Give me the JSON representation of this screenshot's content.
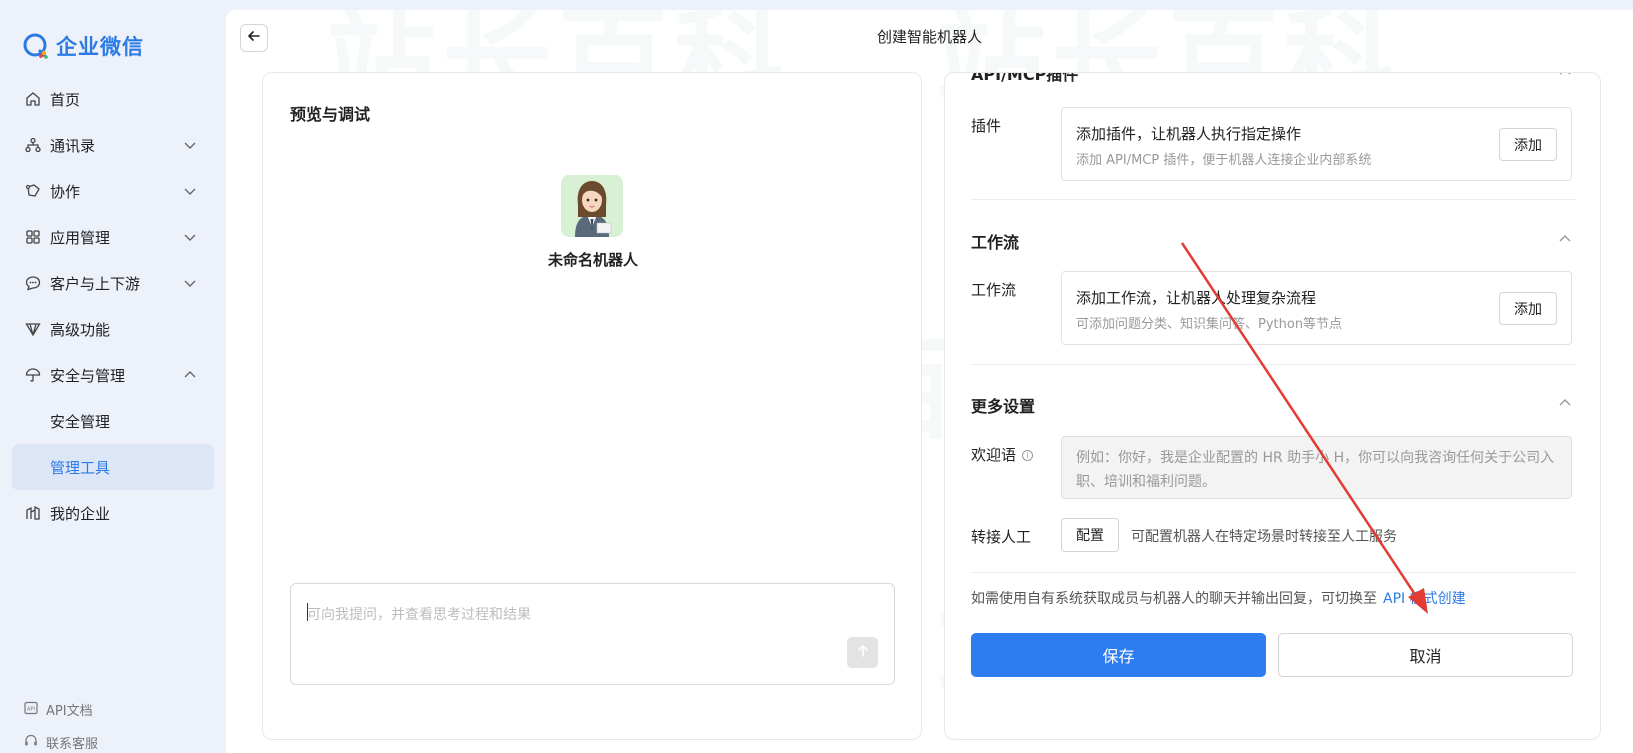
{
  "app": {
    "name": "企业微信"
  },
  "sidebar": {
    "items": [
      {
        "label": "首页",
        "icon": "home-icon"
      },
      {
        "label": "通讯录",
        "icon": "org-chart-icon"
      },
      {
        "label": "协作",
        "icon": "collaboration-icon"
      },
      {
        "label": "应用管理",
        "icon": "apps-grid-icon"
      },
      {
        "label": "客户与上下游",
        "icon": "chat-bubble-icon"
      },
      {
        "label": "高级功能",
        "icon": "diamond-icon"
      },
      {
        "label": "安全与管理",
        "icon": "umbrella-icon"
      },
      {
        "label": "安全管理"
      },
      {
        "label": "管理工具"
      },
      {
        "label": "我的企业",
        "icon": "building-icon"
      }
    ],
    "footer": [
      {
        "label": "API文档",
        "icon": "api-doc-icon"
      },
      {
        "label": "联系客服",
        "icon": "headset-icon"
      }
    ]
  },
  "header": {
    "title": "创建智能机器人"
  },
  "watermark": "站长百科",
  "preview": {
    "title": "预览与调试",
    "bot_name": "未命名机器人",
    "input_placeholder": "可向我提问，并查看思考过程和结果"
  },
  "config": {
    "plugin_section_title": "API/MCP插件",
    "plugin": {
      "label": "插件",
      "title": "添加插件，让机器人执行指定操作",
      "subtitle": "添加 API/MCP 插件，便于机器人连接企业内部系统",
      "button": "添加"
    },
    "workflow_section_title": "工作流",
    "workflow": {
      "label": "工作流",
      "title": "添加工作流，让机器人处理复杂流程",
      "subtitle": "可添加问题分类、知识集问答、Python等节点",
      "button": "添加"
    },
    "more_section_title": "更多设置",
    "welcome": {
      "label": "欢迎语",
      "placeholder": "例如：你好，我是企业配置的 HR 助手小 H，你可以向我咨询任何关于公司入职、培训和福利问题。"
    },
    "handoff": {
      "label": "转接人工",
      "button": "配置",
      "description": "可配置机器人在特定场景时转接至人工服务"
    },
    "api_note": "如需使用自有系统获取成员与机器人的聊天并输出回复，可切换至",
    "api_link": "API 模式创建",
    "save": "保存",
    "cancel": "取消"
  },
  "colors": {
    "accent": "#2d7cf0",
    "annotation_arrow": "#e23b34"
  }
}
